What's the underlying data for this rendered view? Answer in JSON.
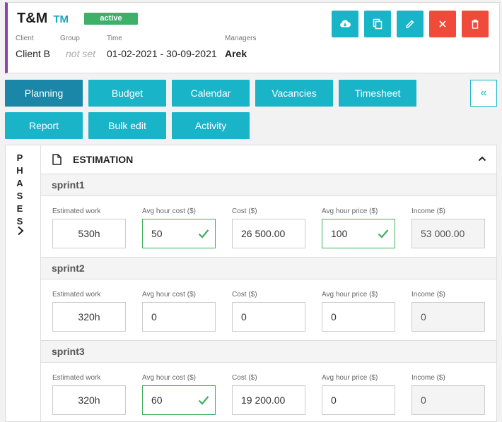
{
  "header": {
    "title": "T&M",
    "code": "TM",
    "status": "active",
    "client_label": "Client",
    "client_value": "Client B",
    "group_label": "Group",
    "group_value": "not set",
    "time_label": "Time",
    "time_value": "01-02-2021 - 30-09-2021",
    "managers_label": "Managers",
    "managers_value": "Arek",
    "actions": [
      "cloud-download-icon",
      "copy-icon",
      "edit-icon",
      "close-icon",
      "trash-icon"
    ],
    "colors": {
      "accent": "#8e44ad",
      "action": "#1ab4c9",
      "danger": "#f04b3a",
      "status": "#3fb06a"
    }
  },
  "tabs": [
    {
      "label": "Planning",
      "active": true
    },
    {
      "label": "Budget"
    },
    {
      "label": "Calendar"
    },
    {
      "label": "Vacancies"
    },
    {
      "label": "Timesheet"
    },
    {
      "label": "Report"
    },
    {
      "label": "Bulk edit"
    },
    {
      "label": "Activity"
    }
  ],
  "collapse_label": "«",
  "phases_label": "PHASES",
  "estimation": {
    "title": "ESTIMATION",
    "sprints": [
      {
        "name": "sprint1",
        "fields": [
          {
            "label": "Estimated work",
            "value": "530h"
          },
          {
            "label": "Avg hour cost ($)",
            "value": "50",
            "valid": true
          },
          {
            "label": "Cost ($)",
            "value": "26 500.00"
          },
          {
            "label": "Avg hour price ($)",
            "value": "100",
            "valid": true
          },
          {
            "label": "Income ($)",
            "value": "53 000.00",
            "readonly": true
          }
        ]
      },
      {
        "name": "sprint2",
        "fields": [
          {
            "label": "Estimated work",
            "value": "320h"
          },
          {
            "label": "Avg hour cost ($)",
            "value": "0"
          },
          {
            "label": "Cost ($)",
            "value": "0"
          },
          {
            "label": "Avg hour price ($)",
            "value": "0"
          },
          {
            "label": "Income ($)",
            "value": "0",
            "readonly": true
          }
        ]
      },
      {
        "name": "sprint3",
        "fields": [
          {
            "label": "Estimated work",
            "value": "320h"
          },
          {
            "label": "Avg hour cost ($)",
            "value": "60",
            "valid": true
          },
          {
            "label": "Cost ($)",
            "value": "19 200.00"
          },
          {
            "label": "Avg hour price ($)",
            "value": "0"
          },
          {
            "label": "Income ($)",
            "value": "0",
            "readonly": true
          }
        ]
      }
    ]
  }
}
